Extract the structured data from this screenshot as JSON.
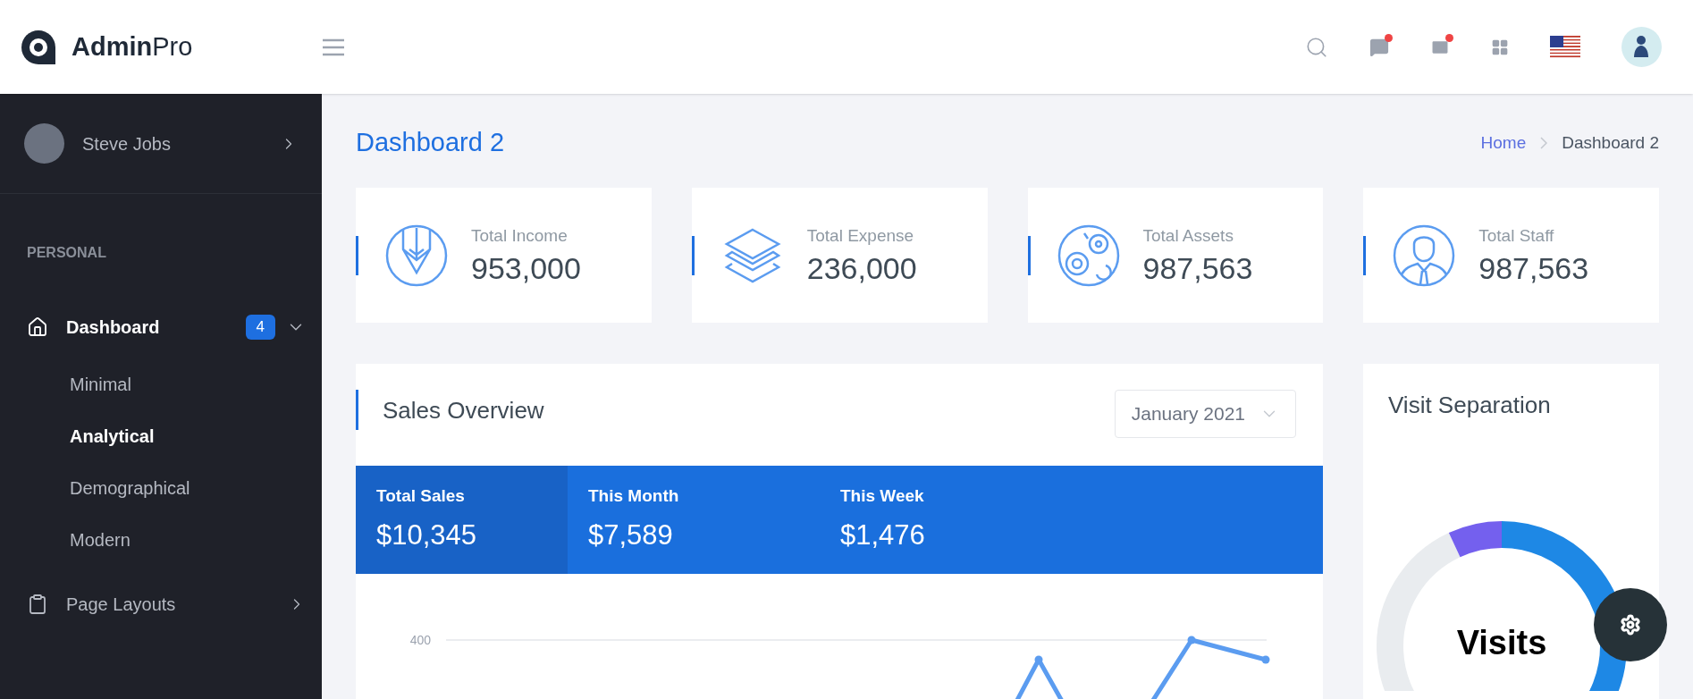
{
  "brand": {
    "name_bold": "Admin",
    "name_light": "Pro"
  },
  "toolbar": [
    {
      "kind": "search",
      "badge": false
    },
    {
      "kind": "chat",
      "badge": true
    },
    {
      "kind": "mail",
      "badge": true
    },
    {
      "kind": "apps",
      "badge": false
    },
    {
      "kind": "flag",
      "badge": false
    },
    {
      "kind": "avatar",
      "badge": false
    }
  ],
  "sidebar": {
    "user": {
      "name": "Steve Jobs"
    },
    "section": "PERSONAL",
    "items": [
      {
        "kind": "home",
        "label": "Dashboard",
        "badge": "4",
        "expanded": true,
        "selected": true,
        "children": [
          {
            "label": "Minimal",
            "selected": false
          },
          {
            "label": "Analytical",
            "selected": true
          },
          {
            "label": "Demographical",
            "selected": false
          },
          {
            "label": "Modern",
            "selected": false
          }
        ]
      },
      {
        "kind": "clipboard",
        "label": "Page Layouts",
        "expanded": false,
        "selected": false
      }
    ]
  },
  "page": {
    "title": "Dashboard 2",
    "breadcrumb": [
      "Home",
      "Dashboard 2"
    ]
  },
  "stats": [
    {
      "label": "Total Income",
      "value": "953,000"
    },
    {
      "label": "Total Expense",
      "value": "236,000"
    },
    {
      "label": "Total Assets",
      "value": "987,563"
    },
    {
      "label": "Total Staff",
      "value": "987,563"
    }
  ],
  "sales": {
    "title": "Sales Overview",
    "period": "January 2021",
    "summary": [
      {
        "label": "Total Sales",
        "value": "$10,345",
        "selected": true
      },
      {
        "label": "This Month",
        "value": "$7,589",
        "selected": false
      },
      {
        "label": "This Week",
        "value": "$1,476",
        "selected": false
      }
    ],
    "tick_label": "400"
  },
  "visits": {
    "title": "Visit Separation",
    "center_label": "Visits"
  }
}
